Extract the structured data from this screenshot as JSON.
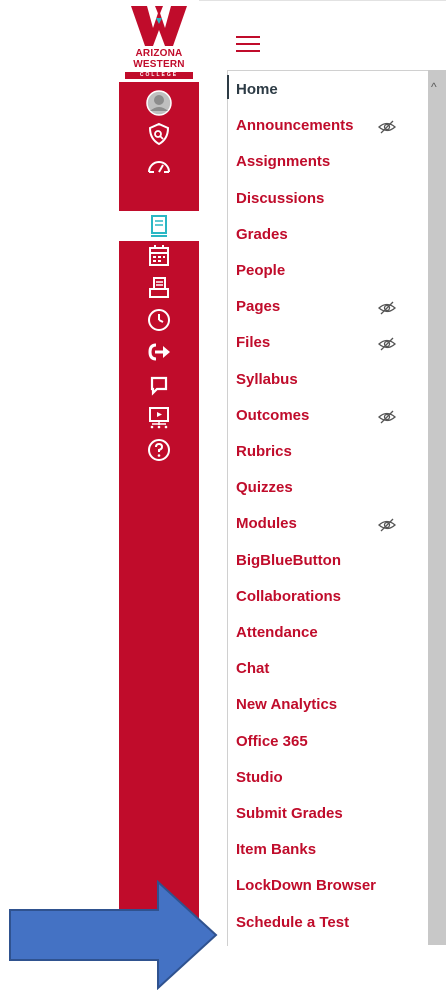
{
  "logo": {
    "line1": "ARIZONA",
    "line2": "WESTERN",
    "line3": "COLLEGE"
  },
  "global_nav": [
    {
      "name": "account-avatar-icon"
    },
    {
      "name": "admin-shield-icon"
    },
    {
      "name": "dashboard-gauge-icon"
    },
    {
      "name": "courses-book-icon",
      "active": true
    },
    {
      "name": "calendar-icon"
    },
    {
      "name": "inbox-icon"
    },
    {
      "name": "history-clock-icon"
    },
    {
      "name": "commons-arrow-icon"
    },
    {
      "name": "chat-bubble-icon"
    },
    {
      "name": "studio-presentation-icon"
    },
    {
      "name": "help-question-icon"
    }
  ],
  "course_menu": [
    {
      "label": "Home",
      "current": true
    },
    {
      "label": "Announcements",
      "hidden_icon": true
    },
    {
      "label": "Assignments"
    },
    {
      "label": "Discussions"
    },
    {
      "label": "Grades"
    },
    {
      "label": "People"
    },
    {
      "label": "Pages",
      "hidden_icon": true
    },
    {
      "label": "Files",
      "hidden_icon": true
    },
    {
      "label": "Syllabus"
    },
    {
      "label": "Outcomes",
      "hidden_icon": true
    },
    {
      "label": "Rubrics"
    },
    {
      "label": "Quizzes"
    },
    {
      "label": "Modules",
      "hidden_icon": true
    },
    {
      "label": "BigBlueButton"
    },
    {
      "label": "Collaborations"
    },
    {
      "label": "Attendance"
    },
    {
      "label": "Chat"
    },
    {
      "label": "New Analytics"
    },
    {
      "label": "Office 365"
    },
    {
      "label": "Studio"
    },
    {
      "label": "Submit Grades"
    },
    {
      "label": "Item Banks"
    },
    {
      "label": "LockDown Browser"
    },
    {
      "label": "Schedule a Test"
    }
  ],
  "colors": {
    "brand": "#c00c2b",
    "arrow": "#4472c4",
    "text_dark": "#2d3b45"
  }
}
